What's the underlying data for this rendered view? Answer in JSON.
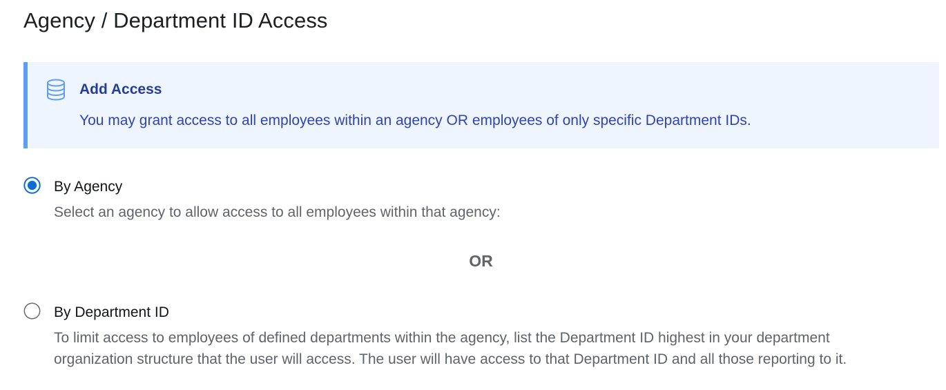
{
  "page": {
    "title": "Agency / Department ID Access"
  },
  "info_alert": {
    "icon": "database-icon",
    "title": "Add Access",
    "text": "You may grant access to all employees within an agency OR employees of only specific Department IDs.",
    "accent_color": "#5d9ef0",
    "background_color": "#eff5fe"
  },
  "options": [
    {
      "label": "By Agency",
      "description": "Select an agency to allow access to all employees within that agency:",
      "selected": true
    },
    {
      "label": "By Department ID",
      "description": "To limit access to employees of defined departments within the agency, list the Department ID highest in your department organization structure that the user will access. The user will have access to that Department ID and all those reporting to it.",
      "selected": false
    }
  ],
  "divider": {
    "text": "OR"
  },
  "colors": {
    "radio_selected": "#0b6fd1",
    "radio_unselected_border": "#6b6b6b"
  }
}
